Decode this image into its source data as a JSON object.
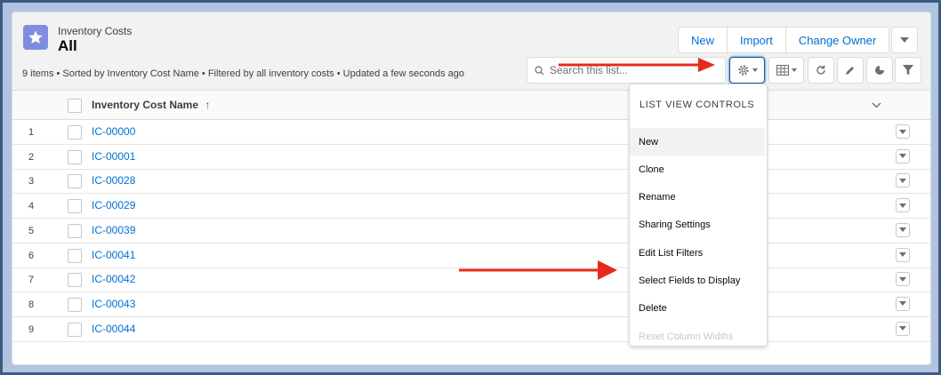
{
  "header": {
    "object_label": "Inventory Costs",
    "list_view_name": "All",
    "info": "9 items • Sorted by Inventory Cost Name • Filtered by all inventory costs • Updated a few seconds ago"
  },
  "actions": {
    "new_label": "New",
    "import_label": "Import",
    "change_owner_label": "Change Owner"
  },
  "search": {
    "placeholder": "Search this list..."
  },
  "table": {
    "column_header": "Inventory Cost Name",
    "sort_indicator": "↑",
    "rows": [
      {
        "num": "1",
        "name": "IC-00000"
      },
      {
        "num": "2",
        "name": "IC-00001"
      },
      {
        "num": "3",
        "name": "IC-00028"
      },
      {
        "num": "4",
        "name": "IC-00029"
      },
      {
        "num": "5",
        "name": "IC-00039"
      },
      {
        "num": "6",
        "name": "IC-00041"
      },
      {
        "num": "7",
        "name": "IC-00042"
      },
      {
        "num": "8",
        "name": "IC-00043"
      },
      {
        "num": "9",
        "name": "IC-00044"
      }
    ]
  },
  "menu": {
    "header": "LIST VIEW CONTROLS",
    "items": [
      {
        "label": "New",
        "state": "hover"
      },
      {
        "label": "Clone",
        "state": "normal"
      },
      {
        "label": "Rename",
        "state": "normal"
      },
      {
        "label": "Sharing Settings",
        "state": "normal"
      },
      {
        "label": "Edit List Filters",
        "state": "normal"
      },
      {
        "label": "Select Fields to Display",
        "state": "normal"
      },
      {
        "label": "Delete",
        "state": "normal"
      },
      {
        "label": "Reset Column Widths",
        "state": "disabled"
      }
    ]
  },
  "colors": {
    "brand_blue": "#0070d2",
    "object_icon": "#7f8de1",
    "annotation_arrow": "#e8291c",
    "outer_border": "#3b5b85"
  },
  "icons": [
    "star-icon",
    "search-icon",
    "gear-icon",
    "table-icon",
    "refresh-icon",
    "pencil-icon",
    "pie-chart-icon",
    "filter-icon",
    "chevron-down-icon",
    "arrow-up-icon"
  ]
}
